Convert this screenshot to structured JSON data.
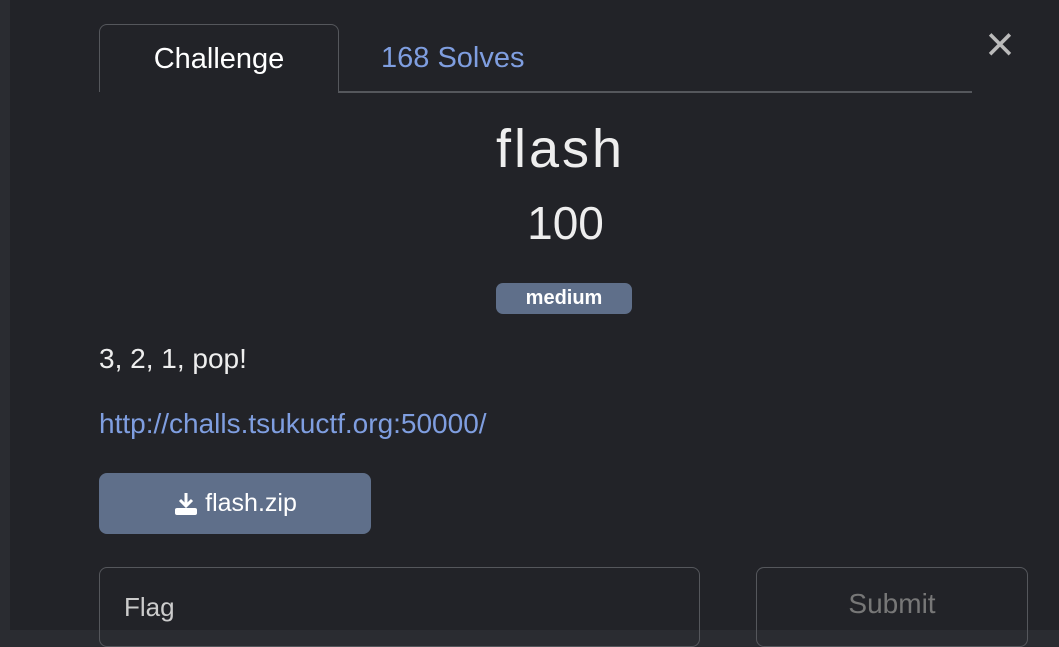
{
  "tabs": [
    {
      "label": "Challenge"
    },
    {
      "label": "168 Solves"
    }
  ],
  "close_icon": "close-icon",
  "challenge": {
    "name": "flash",
    "value": "100",
    "difficulty": "medium",
    "description": "3, 2, 1, pop!",
    "link": "http://challs.tsukuctf.org:50000/",
    "file": "flash.zip"
  },
  "form": {
    "flag_placeholder": "Flag",
    "submit_label": "Submit"
  },
  "colors": {
    "accent": "#7f9ee0",
    "badge": "#5f6f8a",
    "background": "#222328"
  }
}
